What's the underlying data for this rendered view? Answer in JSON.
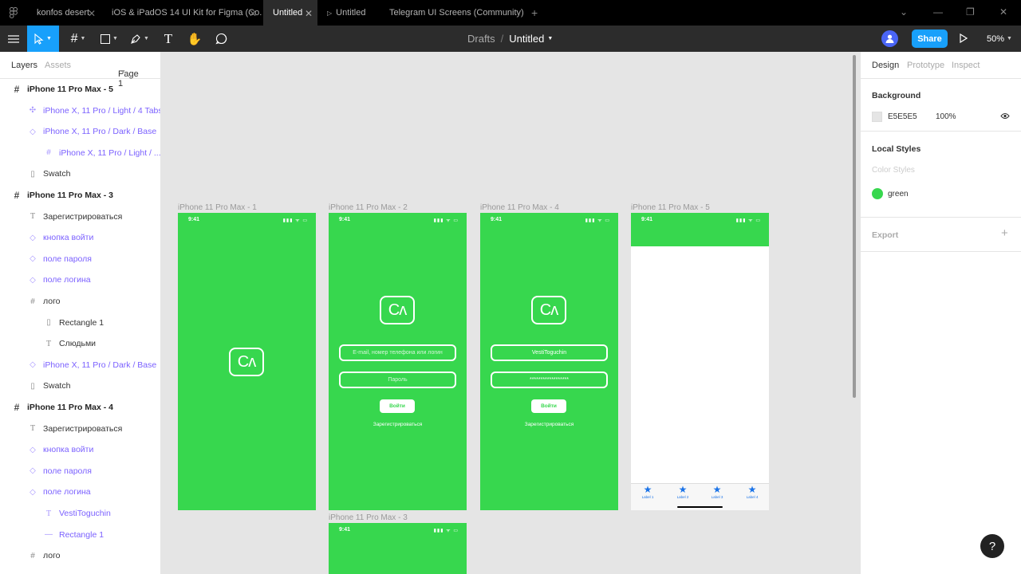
{
  "tabs": [
    {
      "label": "konfos desert"
    },
    {
      "label": "iOS & iPadOS 14 UI Kit for Figma (Co..."
    },
    {
      "label": "Untitled"
    },
    {
      "label": "Untitled"
    },
    {
      "label": "Telegram UI Screens (Community)"
    }
  ],
  "toolbar": {
    "drafts": "Drafts",
    "separator": "/",
    "file_name": "Untitled",
    "share_label": "Share",
    "zoom": "50%"
  },
  "left_panel": {
    "tab_layers": "Layers",
    "tab_assets": "Assets",
    "page": "Page 1",
    "layers": [
      {
        "name": "iPhone 11 Pro Max - 5",
        "type": "frame",
        "icon": "frame-icon"
      },
      {
        "name": "iPhone X, 11 Pro / Light / 4 Tabs",
        "type": "comp",
        "icon": "component-icon"
      },
      {
        "name": "iPhone X, 11 Pro / Dark / Base",
        "type": "comp",
        "icon": "instance-icon"
      },
      {
        "name": "iPhone X, 11 Pro / Light / ...",
        "type": "comp",
        "icon": "frame-icon"
      },
      {
        "name": "Swatch",
        "type": "plain",
        "icon": "rectangle-icon"
      },
      {
        "name": "iPhone 11 Pro Max - 3",
        "type": "frame",
        "icon": "frame-icon"
      },
      {
        "name": "Зарегистрироваться",
        "type": "plain",
        "icon": "text-icon"
      },
      {
        "name": "кнопка войти",
        "type": "comp",
        "icon": "instance-icon"
      },
      {
        "name": "поле пароля",
        "type": "comp",
        "icon": "instance-icon"
      },
      {
        "name": "поле логина",
        "type": "comp",
        "icon": "instance-icon"
      },
      {
        "name": "лого",
        "type": "plain",
        "icon": "frame-icon"
      },
      {
        "name": "Rectangle 1",
        "type": "plain",
        "icon": "rectangle-icon"
      },
      {
        "name": "Слюдьми",
        "type": "plain",
        "icon": "text-icon"
      },
      {
        "name": "iPhone X, 11 Pro / Dark / Base",
        "type": "comp",
        "icon": "instance-icon"
      },
      {
        "name": "Swatch",
        "type": "plain",
        "icon": "rectangle-icon"
      },
      {
        "name": "iPhone 11 Pro Max - 4",
        "type": "frame",
        "icon": "frame-icon"
      },
      {
        "name": "Зарегистрироваться",
        "type": "plain",
        "icon": "text-icon"
      },
      {
        "name": "кнопка войти",
        "type": "comp",
        "icon": "instance-icon"
      },
      {
        "name": "поле пароля",
        "type": "comp",
        "icon": "instance-icon"
      },
      {
        "name": "поле логина",
        "type": "comp",
        "icon": "instance-icon"
      },
      {
        "name": "VestiToguchin",
        "type": "comp",
        "icon": "text-icon"
      },
      {
        "name": "Rectangle 1",
        "type": "comp",
        "icon": "line-icon"
      },
      {
        "name": "лого",
        "type": "plain",
        "icon": "frame-icon"
      }
    ]
  },
  "canvas": {
    "frames": [
      {
        "label": "iPhone 11 Pro Max - 1"
      },
      {
        "label": "iPhone 11 Pro Max - 2"
      },
      {
        "label": "iPhone 11 Pro Max - 4"
      },
      {
        "label": "iPhone 11 Pro Max - 5"
      },
      {
        "label": "iPhone 11 Pro Max - 3"
      }
    ],
    "status_time": "9:41",
    "status_icons": "▮▮▮ ᯤ ▭",
    "logo_text": "Cʌ",
    "login_placeholder": "E-mail, номер телефона или логин",
    "password_placeholder": "Пароль",
    "login_value": "VestiToguchin",
    "password_value": "******************",
    "login_button": "Войти",
    "register_link": "Зарегистрироваться",
    "ios_tab_labels": [
      "Label 1",
      "Label 2",
      "Label 3",
      "Label 4"
    ],
    "accent_green": "#37d74e"
  },
  "right_panel": {
    "tab_design": "Design",
    "tab_prototype": "Prototype",
    "tab_inspect": "Inspect",
    "background_title": "Background",
    "background_hex": "E5E5E5",
    "background_opacity": "100%",
    "local_styles_title": "Local Styles",
    "color_styles_label": "Color Styles",
    "style_green": "green",
    "export_title": "Export"
  },
  "help_label": "?"
}
